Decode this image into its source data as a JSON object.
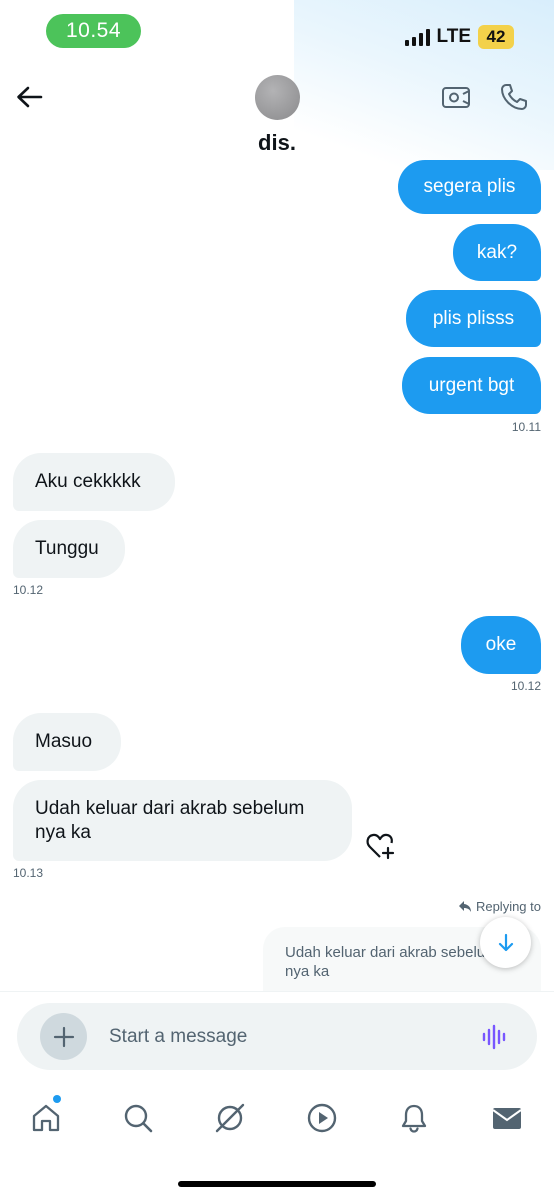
{
  "status_bar": {
    "time": "10.54",
    "network": "LTE",
    "battery": "42"
  },
  "header": {
    "contact_name": "dis.",
    "back_icon": "arrow-left-icon",
    "video_icon": "video-camera-icon",
    "call_icon": "phone-icon"
  },
  "colors": {
    "accent": "#1d9bf0",
    "status_green": "#4cc35a",
    "battery_yellow": "#f3d14a",
    "incoming_bubble": "#eff3f4"
  },
  "messages": [
    {
      "direction": "outgoing",
      "text": "segera plis"
    },
    {
      "direction": "outgoing",
      "text": "kak?"
    },
    {
      "direction": "outgoing",
      "text": "plis plisss"
    },
    {
      "direction": "outgoing",
      "text": "urgent bgt"
    },
    {
      "direction": "incoming",
      "text": "Aku cekkkkk"
    },
    {
      "direction": "incoming",
      "text": "Tunggu"
    },
    {
      "direction": "outgoing",
      "text": "oke"
    },
    {
      "direction": "incoming",
      "text": "Masuo"
    },
    {
      "direction": "incoming",
      "text": "Udah keluar dari akrab sebelum nya ka"
    }
  ],
  "timestamps": [
    "10.11",
    "10.12",
    "10.12",
    "10.13"
  ],
  "reply": {
    "label": "Replying to",
    "preview": "Udah keluar dari akrab sebelum nya ka"
  },
  "composer": {
    "placeholder": "Start a message"
  },
  "nav": {
    "items": [
      "home-icon",
      "search-icon",
      "grok-icon",
      "video-play-icon",
      "bell-icon",
      "mail-icon"
    ]
  }
}
